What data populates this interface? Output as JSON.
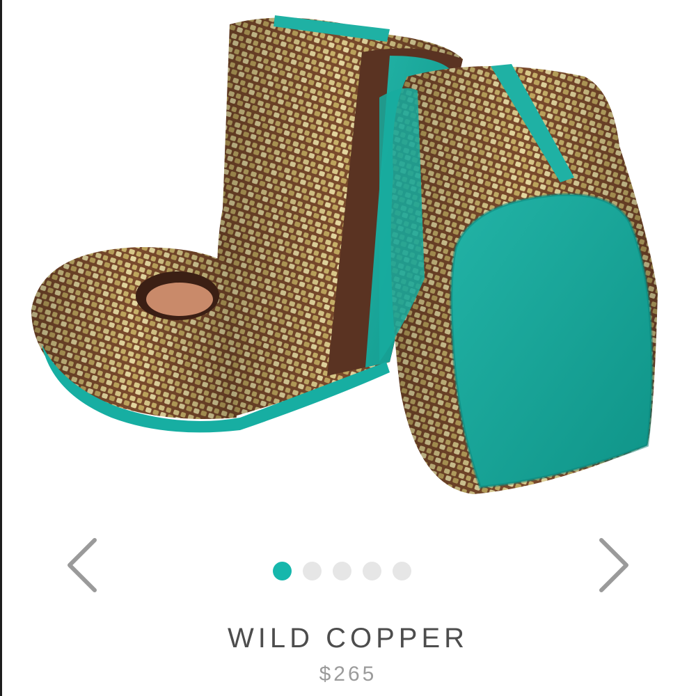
{
  "product": {
    "name": "WILD COPPER",
    "price": "$265",
    "image_alt": "Wild Copper folding ballet flats with turquoise soles"
  },
  "carousel": {
    "prev_icon": "chevron-left-icon",
    "next_icon": "chevron-right-icon",
    "slide_count": 5,
    "active_index": 0
  },
  "colors": {
    "accent": "#16b7ac",
    "dot_inactive": "#e6e6e6",
    "title_text": "#4d4d4d",
    "price_text": "#9b9b9b",
    "arrow": "#9a9a9a"
  }
}
